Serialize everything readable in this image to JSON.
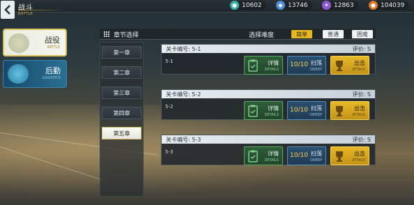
{
  "header": {
    "title": "战斗",
    "subtitle": "BATTLE"
  },
  "resources": [
    {
      "icon": "coin-icon",
      "value": "10602",
      "color": "#3bb0a8"
    },
    {
      "icon": "crystal-icon",
      "value": "13746",
      "color": "#4e8fd6"
    },
    {
      "icon": "feather-icon",
      "value": "12863",
      "color": "#8a5bd1"
    },
    {
      "icon": "fuel-icon",
      "value": "104039",
      "color": "#d9782a"
    }
  ],
  "side_tabs": [
    {
      "label": "战役",
      "sub": "BATTLE",
      "active": true
    },
    {
      "label": "后勤",
      "sub": "LOGISTICS",
      "active": false
    }
  ],
  "panel": {
    "title": "章节选择",
    "difficulty_label": "选择难度",
    "difficulties": [
      "简单",
      "普通",
      "困难"
    ],
    "selected_difficulty": "简单"
  },
  "chapters": [
    "第一章",
    "第二章",
    "第三章",
    "第四章",
    "第五章"
  ],
  "active_chapter": "第五章",
  "stages": [
    {
      "code_label": "关卡编号: 5-1",
      "rating": "评价: S",
      "name": "5-1",
      "sweep_count": "10/10"
    },
    {
      "code_label": "关卡编号: 5-2",
      "rating": "评价: S",
      "name": "5-2",
      "sweep_count": "10/10"
    },
    {
      "code_label": "关卡编号: 5-3",
      "rating": "评价: S",
      "name": "5-3",
      "sweep_count": "10/10"
    }
  ],
  "actions": {
    "detail_label": "详情",
    "detail_sub": "DETAILS",
    "sweep_label": "扫荡",
    "sweep_sub": "SWEEP",
    "attack_label": "出击",
    "attack_sub": "ATTACK"
  },
  "colors": {
    "accent_gold": "#e7b823",
    "detail_green": "#55ad63",
    "sweep_blue": "#4d8fc4"
  }
}
